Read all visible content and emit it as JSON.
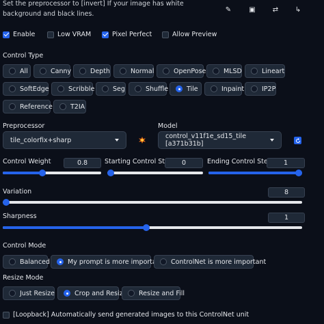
{
  "hint": "Set the preprocessor to [invert] If your image has white background and black lines.",
  "toolbar": [
    "edit-icon",
    "camera-icon",
    "swap-icon",
    "send-icon"
  ],
  "toolbar_glyphs": [
    "✎",
    "▣",
    "⇄",
    "↳"
  ],
  "checkboxes": {
    "enable": {
      "label": "Enable",
      "checked": true
    },
    "low_vram": {
      "label": "Low VRAM",
      "checked": false
    },
    "pixel_perfect": {
      "label": "Pixel Perfect",
      "checked": true
    },
    "allow_preview": {
      "label": "Allow Preview",
      "checked": false
    }
  },
  "control_type": {
    "label": "Control Type",
    "options": [
      "All",
      "Canny",
      "Depth",
      "Normal",
      "OpenPose",
      "MLSD",
      "Lineart",
      "SoftEdge",
      "Scribble",
      "Seg",
      "Shuffle",
      "Tile",
      "Inpaint",
      "IP2P",
      "Reference",
      "T2IA"
    ],
    "selected": "Tile"
  },
  "preprocessor": {
    "label": "Preprocessor",
    "value": "tile_colorfix+sharp"
  },
  "model": {
    "label": "Model",
    "value": "control_v11f1e_sd15_tile [a371b31b]"
  },
  "sliders": {
    "control_weight": {
      "label": "Control Weight",
      "value": "0.8",
      "fraction": 0.4
    },
    "starting_step": {
      "label": "Starting Control Step",
      "value": "0",
      "fraction": 0.0
    },
    "ending_step": {
      "label": "Ending Control Step",
      "value": "1",
      "fraction": 1.0
    },
    "variation": {
      "label": "Variation",
      "value": "8",
      "fraction": 0.0
    },
    "sharpness": {
      "label": "Sharpness",
      "value": "1",
      "fraction": 0.48
    }
  },
  "control_mode": {
    "label": "Control Mode",
    "options": [
      "Balanced",
      "My prompt is more important",
      "ControlNet is more important"
    ],
    "selected": "My prompt is more important"
  },
  "resize_mode": {
    "label": "Resize Mode",
    "options": [
      "Just Resize",
      "Crop and Resize",
      "Resize and Fill"
    ],
    "selected": "Crop and Resize"
  },
  "loopback": {
    "label": "[Loopback] Automatically send generated images to this ControlNet unit",
    "checked": false
  }
}
